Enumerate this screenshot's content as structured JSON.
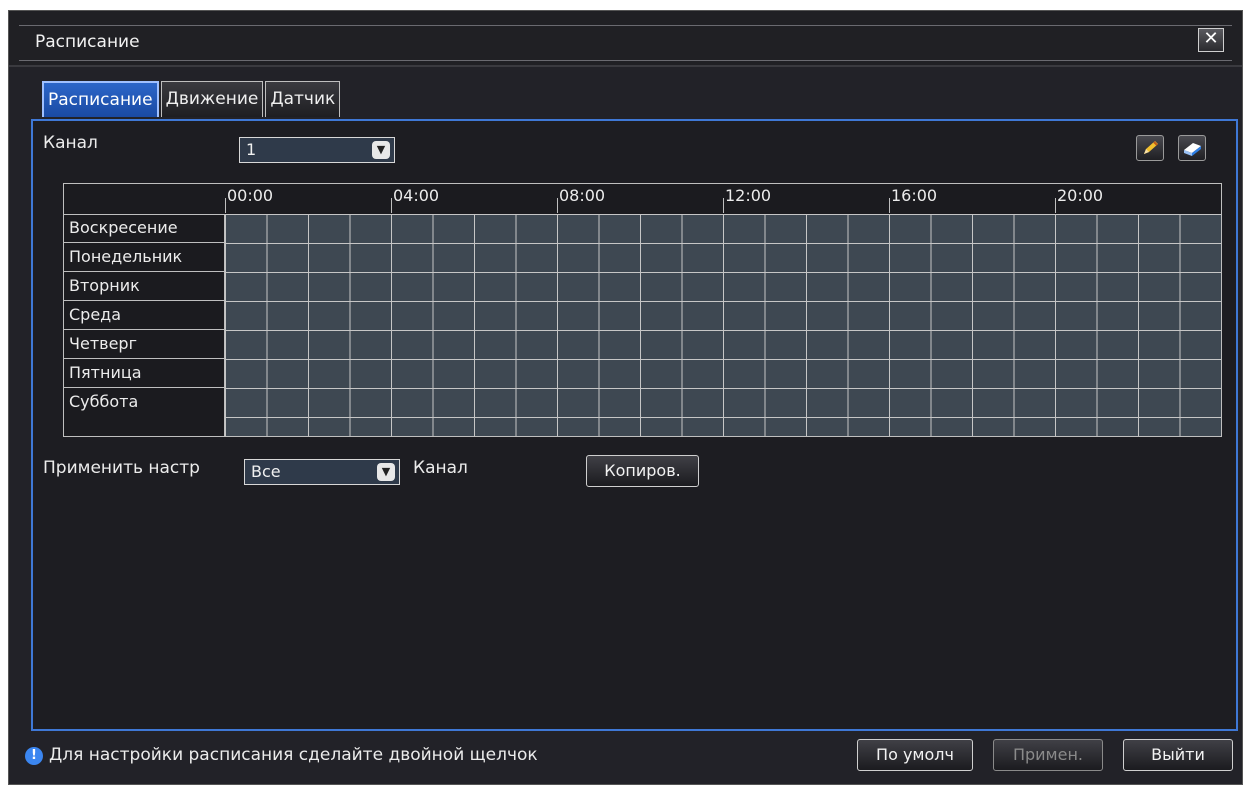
{
  "window": {
    "title": "Расписание",
    "close_symbol": "✕"
  },
  "tabs": [
    {
      "label": "Расписание",
      "active": true
    },
    {
      "label": "Движение",
      "active": false
    },
    {
      "label": "Датчик",
      "active": false
    }
  ],
  "channel": {
    "label": "Канал",
    "value": "1"
  },
  "schedule": {
    "times": [
      "00:00",
      "04:00",
      "08:00",
      "12:00",
      "16:00",
      "20:00"
    ],
    "days": [
      "Воскресение",
      "Понедельник",
      "Вторник",
      "Среда",
      "Четверг",
      "Пятница",
      "Суббота"
    ]
  },
  "apply": {
    "label": "Применить настр",
    "value": "Все",
    "channel_label": "Канал",
    "copy_button": "Копиров."
  },
  "footer": {
    "hint": "Для настройки расписания сделайте двойной щелчок",
    "default_button": "По умолч",
    "apply_button": "Примен.",
    "exit_button": "Выйти"
  },
  "icons": {
    "edit": "pencil-icon",
    "erase": "eraser-icon",
    "hint": "info-icon"
  },
  "colors": {
    "accent": "#3f78d6",
    "cell": "#3e4852",
    "tab_active": "#2c66c9"
  }
}
